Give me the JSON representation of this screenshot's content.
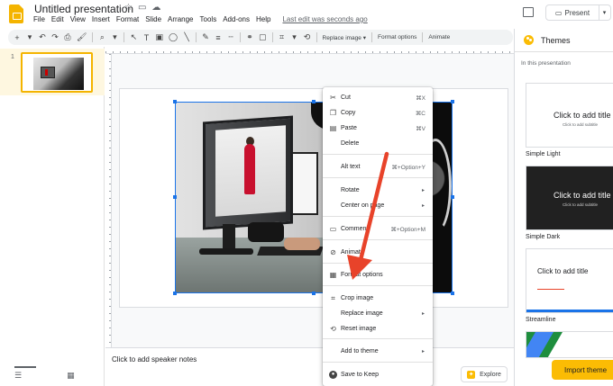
{
  "header": {
    "doc_title": "Untitled presentation",
    "menu": [
      "File",
      "Edit",
      "View",
      "Insert",
      "Format",
      "Slide",
      "Arrange",
      "Tools",
      "Add-ons",
      "Help"
    ],
    "last_edit": "Last edit was seconds ago",
    "present_label": "Present"
  },
  "toolbar": {
    "replace_image": "Replace image ▾",
    "format_options": "Format options",
    "animate": "Animate"
  },
  "filmstrip": {
    "slide_number": "1"
  },
  "notes": {
    "placeholder": "Click to add speaker notes",
    "explore_label": "Explore"
  },
  "themes": {
    "title": "Themes",
    "subtitle": "In this presentation",
    "cards": [
      {
        "label": "",
        "title": "Click to add title",
        "sub": "Click to add subtitle",
        "style": "white"
      },
      {
        "label": "Simple Light",
        "title": "Click to add title",
        "sub": "Click to add subtitle",
        "style": "dark"
      },
      {
        "label": "Simple Dark",
        "title": "Click to add title",
        "sub": "",
        "style": "streamline"
      },
      {
        "label": "Streamline",
        "title": "",
        "sub": "",
        "style": "focus"
      }
    ],
    "import_label": "Import theme"
  },
  "context_menu": {
    "items": [
      {
        "icon": "cut-icon",
        "label": "Cut",
        "shortcut": "⌘X"
      },
      {
        "icon": "copy-icon",
        "label": "Copy",
        "shortcut": "⌘C"
      },
      {
        "icon": "paste-icon",
        "label": "Paste",
        "shortcut": "⌘V"
      },
      {
        "icon": "",
        "label": "Delete",
        "shortcut": ""
      },
      {
        "icon": "",
        "label": "Alt text",
        "shortcut": "⌘+Option+Y"
      },
      {
        "icon": "",
        "label": "Rotate",
        "shortcut": "▸"
      },
      {
        "icon": "",
        "label": "Center on page",
        "shortcut": "▸"
      },
      {
        "icon": "comment-icon",
        "label": "Comment",
        "shortcut": "⌘+Option+M"
      },
      {
        "icon": "animate-icon",
        "label": "Animate",
        "shortcut": ""
      },
      {
        "icon": "format-options-icon",
        "label": "Format options",
        "shortcut": ""
      },
      {
        "icon": "crop-icon",
        "label": "Crop image",
        "shortcut": ""
      },
      {
        "icon": "",
        "label": "Replace image",
        "shortcut": "▸"
      },
      {
        "icon": "reset-icon",
        "label": "Reset image",
        "shortcut": ""
      },
      {
        "icon": "",
        "label": "Add to theme",
        "shortcut": "▸"
      },
      {
        "icon": "keep-icon",
        "label": "Save to Keep",
        "shortcut": ""
      }
    ]
  },
  "colors": {
    "accent": "#1a73e8",
    "brand": "#f4b400",
    "annotation": "#e8432a"
  }
}
